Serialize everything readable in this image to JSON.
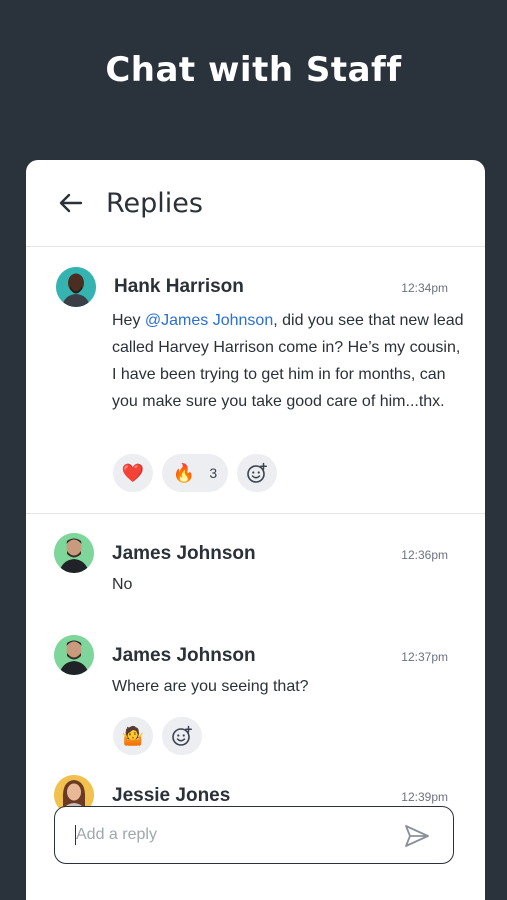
{
  "promo": {
    "title": "Chat with Staff"
  },
  "header": {
    "title": "Replies",
    "back_icon": "arrow-left-icon"
  },
  "messages": [
    {
      "author": "Hank Harrison",
      "time": "12:34pm",
      "text_before": "Hey ",
      "mention": "@James Johnson",
      "text_after": ", did you see that new lead called Harvey Harrison come in? He’s my cousin, I have been trying to get him in for months, can you make sure you take good care of him...thx.",
      "reactions": [
        {
          "emoji": "❤️",
          "count": ""
        },
        {
          "emoji": "🔥",
          "count": "3"
        }
      ]
    },
    {
      "author": "James Johnson",
      "time": "12:36pm",
      "text": "No"
    },
    {
      "author": "James Johnson",
      "time": "12:37pm",
      "text": "Where are you seeing that?",
      "reactions": [
        {
          "emoji": "🤷",
          "count": ""
        }
      ]
    },
    {
      "author": "Jessie Jones",
      "time": "12:39pm"
    }
  ],
  "composer": {
    "placeholder": "Add a reply",
    "send_icon": "send-icon"
  },
  "colors": {
    "background": "#2a323c",
    "mention": "#2a6fd6",
    "card": "#ffffff"
  }
}
